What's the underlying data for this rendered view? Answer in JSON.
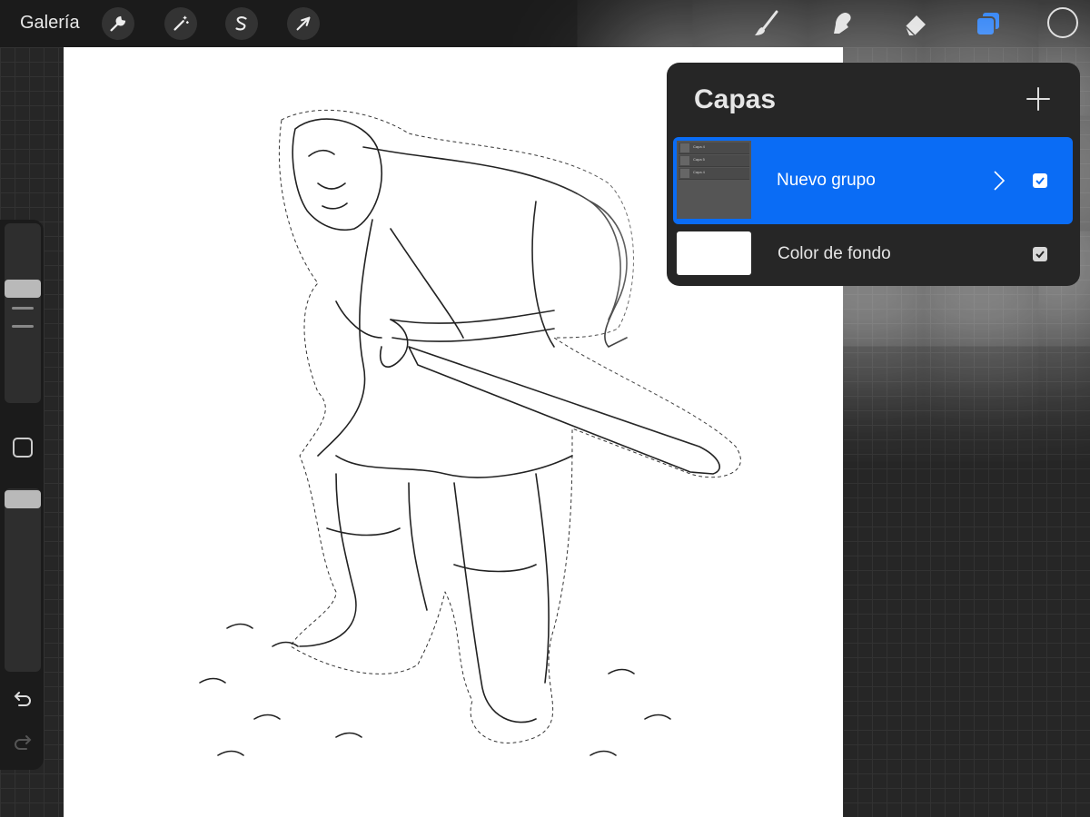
{
  "topbar": {
    "gallery_label": "Galería",
    "actions": [
      "wrench-icon",
      "magic-wand-icon",
      "selection-s-icon",
      "transform-arrow-icon"
    ],
    "tools": [
      "brush-icon",
      "smudge-icon",
      "eraser-icon",
      "layers-icon"
    ],
    "accent_color": "#0a6cf5"
  },
  "layers": {
    "title": "Capas",
    "items": [
      {
        "name": "Nuevo grupo",
        "selected": true,
        "visible": true,
        "children": [
          "Capa 4",
          "Capa 5",
          "Capa 4"
        ]
      },
      {
        "name": "Color de fondo",
        "selected": false,
        "visible": true
      }
    ]
  }
}
